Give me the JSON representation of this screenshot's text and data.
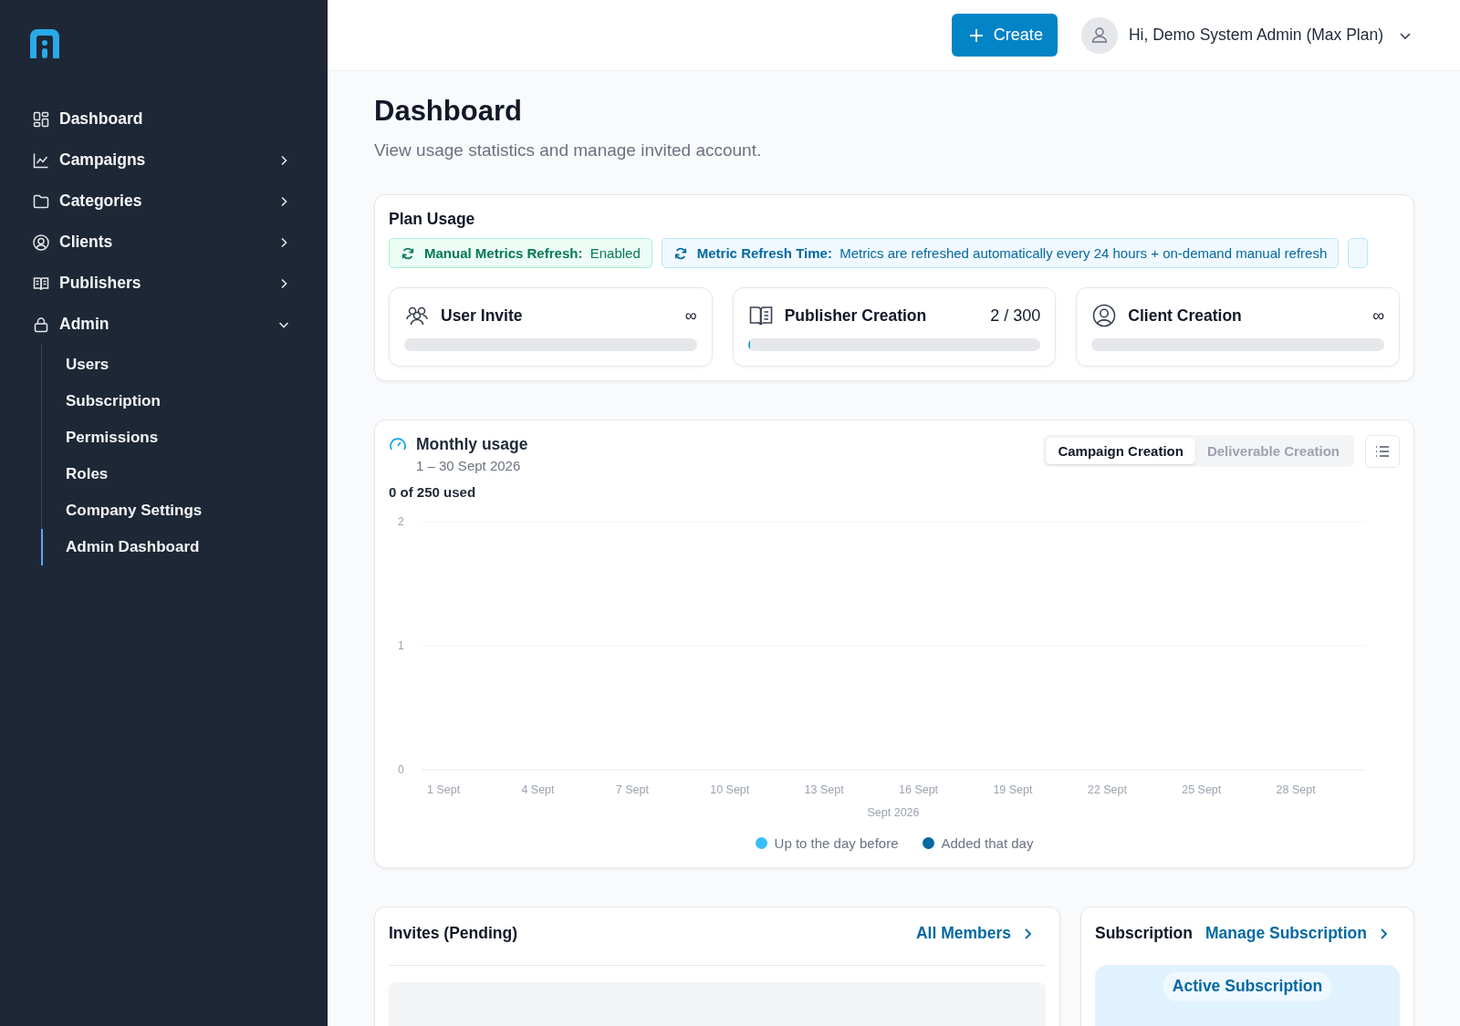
{
  "sidebar": {
    "items": [
      {
        "kind": "link",
        "label": "Dashboard"
      },
      {
        "kind": "group",
        "label": "Campaigns",
        "expanded": false
      },
      {
        "kind": "group",
        "label": "Categories",
        "expanded": false
      },
      {
        "kind": "group",
        "label": "Clients",
        "expanded": false
      },
      {
        "kind": "group",
        "label": "Publishers",
        "expanded": false
      },
      {
        "kind": "group",
        "label": "Admin",
        "expanded": true,
        "children": [
          {
            "label": "Users",
            "selected": false
          },
          {
            "label": "Subscription",
            "selected": false
          },
          {
            "label": "Permissions",
            "selected": false
          },
          {
            "label": "Roles",
            "selected": false
          },
          {
            "label": "Company Settings",
            "selected": false
          },
          {
            "label": "Admin Dashboard",
            "selected": true
          }
        ]
      }
    ]
  },
  "header": {
    "create_button": "Create",
    "user_greeting": "Hi, Demo System Admin (Max Plan)"
  },
  "page": {
    "title": "Dashboard",
    "subtitle": "View usage statistics and manage invited account."
  },
  "plan_usage": {
    "title": "Plan Usage",
    "chips": [
      {
        "kind": "success",
        "label": "Manual Metrics Refresh:",
        "value": "Enabled"
      },
      {
        "kind": "info",
        "label": "Metric Refresh Time:",
        "value": "Metrics are refreshed automatically every 24 hours + on-demand manual refresh"
      },
      {
        "kind": "info"
      }
    ],
    "cards": [
      {
        "title": "User Invite",
        "limit": "∞"
      },
      {
        "title": "Publisher Creation",
        "limit": "2 / 300",
        "level": 0.0067
      },
      {
        "title": "Client Creation",
        "limit": "∞"
      }
    ]
  },
  "monthly_usage": {
    "title": "Monthly usage",
    "period": "1 – 30 Sept 2026",
    "summary": "0 of 250 used",
    "tabs": [
      {
        "label": "Campaign Creation",
        "selected": true
      },
      {
        "label": "Deliverable Creation",
        "selected": false
      }
    ],
    "chart_data": {
      "type": "line",
      "legend": "bottom",
      "xlabel": "Sept 2026",
      "categories": [
        "1 Sept",
        "4 Sept",
        "7 Sept",
        "10 Sept",
        "13 Sept",
        "16 Sept",
        "19 Sept",
        "22 Sept",
        "25 Sept",
        "28 Sept"
      ],
      "ylim": [
        0,
        2
      ],
      "yticks": [
        0,
        1,
        2
      ],
      "series": [
        {
          "name": "Up to the day before",
          "color": "#38bdf8",
          "values": [
            null,
            null,
            null,
            null,
            null,
            null,
            null,
            null,
            null,
            null
          ]
        },
        {
          "name": "Added that day",
          "color": "#0369a1",
          "values": [
            null,
            null,
            null,
            null,
            null,
            null,
            null,
            null,
            null,
            null
          ]
        }
      ]
    }
  },
  "invites": {
    "title": "Invites (Pending)",
    "link": "All Members"
  },
  "subscription": {
    "title": "Subscription",
    "link": "Manage Subscription",
    "status": "Active Subscription"
  }
}
